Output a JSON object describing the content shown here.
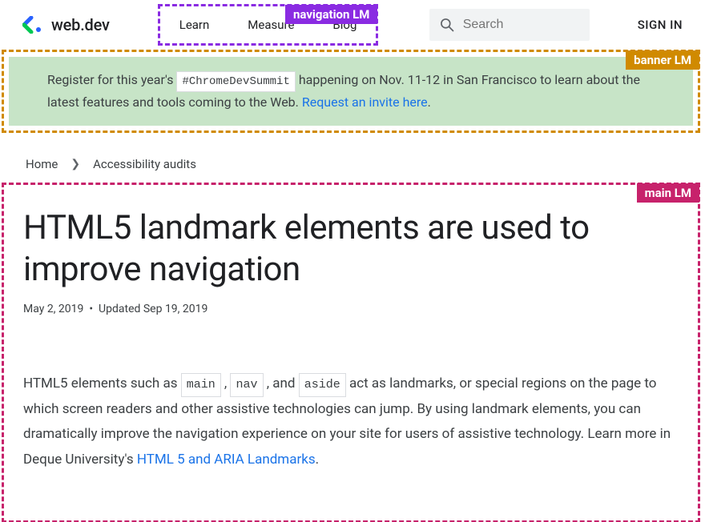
{
  "header": {
    "brand": "web.dev",
    "nav": {
      "items": [
        "Learn",
        "Measure",
        "Blog"
      ]
    },
    "search": {
      "placeholder": "Search"
    },
    "signin": "SIGN IN"
  },
  "landmark_labels": {
    "nav": "navigation LM",
    "banner": "banner LM",
    "main": "main LM"
  },
  "banner": {
    "pre_text": "Register for this year's ",
    "hashtag": "#ChromeDevSummit",
    "mid_text": " happening on Nov. 11-12 in San Francisco to learn about the latest features and tools coming to the Web. ",
    "link_text": "Request an invite here",
    "suffix": "."
  },
  "breadcrumb": {
    "home": "Home",
    "current": "Accessibility audits"
  },
  "article": {
    "title": "HTML5 landmark elements are used to improve navigation",
    "date": "May 2, 2019",
    "sep": "•",
    "updated": "Updated Sep 19, 2019",
    "p1a": "HTML5 elements such as ",
    "el1": "main",
    "p1b": " , ",
    "el2": "nav",
    "p1c": " , and ",
    "el3": "aside",
    "p1d": "  act as landmarks, or special regions on the page to which screen readers and other assistive technologies can jump. By using landmark elements, you can dramatically improve the navigation experience on your site for users of assistive technology. Learn more in Deque University's ",
    "link": "HTML 5 and ARIA Landmarks",
    "p1e": "."
  }
}
